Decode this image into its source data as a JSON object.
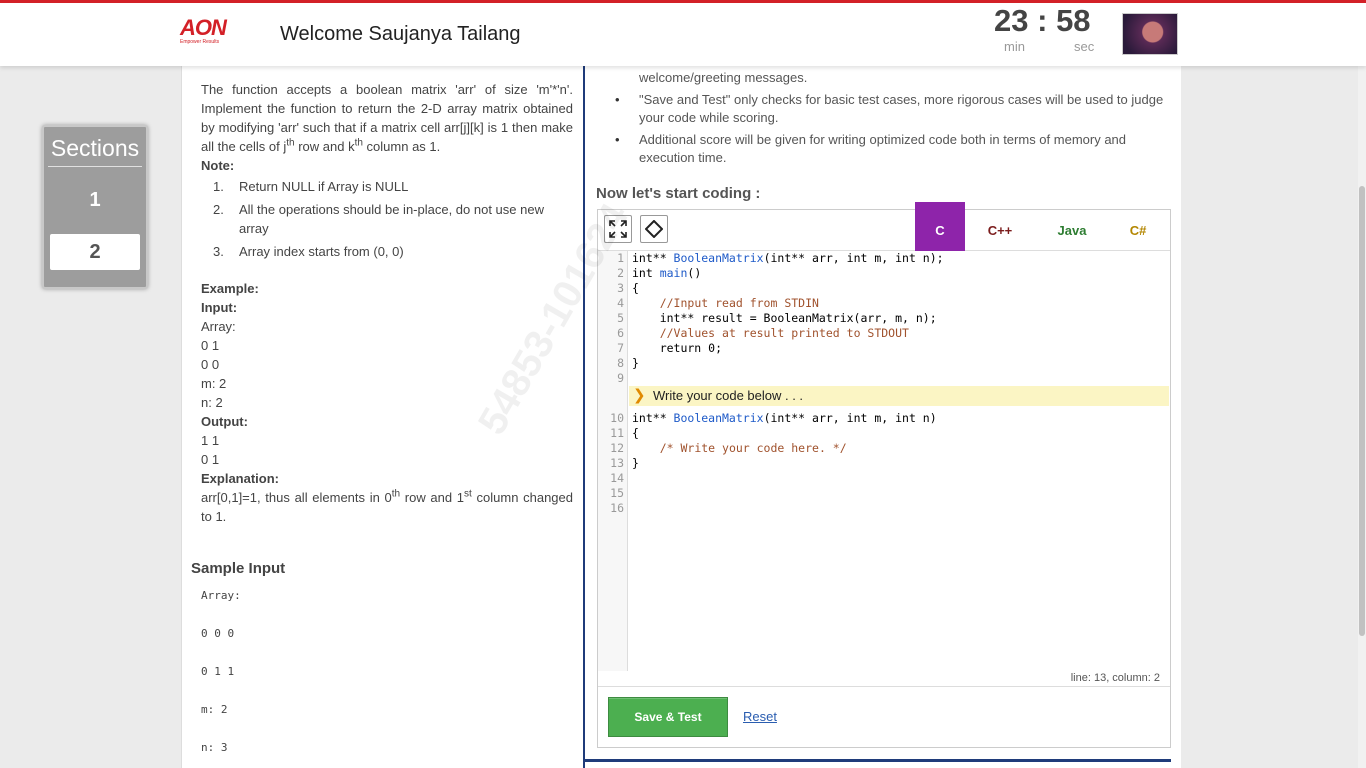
{
  "header": {
    "logo_text": "AON",
    "logo_tagline": "Empower Results",
    "welcome": "Welcome Saujanya Tailang",
    "timer": {
      "minutes": "23",
      "separator": ":",
      "seconds": "58",
      "min_label": "min",
      "sec_label": "sec"
    }
  },
  "sidebar": {
    "title": "Sections",
    "items": [
      {
        "label": "1",
        "active": false
      },
      {
        "label": "2",
        "active": true
      }
    ]
  },
  "question": {
    "para": {
      "t1": "The function accepts a boolean matrix 'arr' of size 'm'*'n'. Implement the function to return the 2-D array matrix obtained by modifying 'arr' such that if a matrix cell arr[j][k] is 1 then make all the cells of j",
      "sup1": "th",
      "t2": " row and k",
      "sup2": "th",
      "t3": " column as 1."
    },
    "note_label": "Note:",
    "notes": [
      {
        "num": "1.",
        "text": "Return NULL if Array is NULL"
      },
      {
        "num": "2.",
        "text": "All the operations should be in-place, do not use new array"
      },
      {
        "num": "3.",
        "text": "Array index starts from (0, 0)"
      }
    ],
    "example_label": "Example:",
    "input_label": "Input:",
    "input_lines": [
      "Array:",
      "0 1",
      "0 0",
      "m: 2",
      "n: 2"
    ],
    "output_label": "Output:",
    "output_lines": [
      "1 1",
      "0 1"
    ],
    "explanation_label": "Explanation:",
    "explanation": {
      "t1": "arr[0,1]=1, thus all elements in 0",
      "sup1": "th",
      "t2": " row and 1",
      "sup2": "st",
      "t3": " column changed to 1."
    },
    "sample_input_title": "Sample Input",
    "sample_input_lines": [
      "Array:",
      "",
      "0 0 0",
      "",
      "0 1 1",
      "",
      "m: 2",
      "",
      "n: 3"
    ]
  },
  "watermark": "54853-101624",
  "instructions": [
    {
      "text": "welcome/greeting messages.",
      "bullet": false
    },
    {
      "text": "\"Save and Test\" only checks for basic test cases, more rigorous cases will be used to judge your code while scoring.",
      "bullet": true
    },
    {
      "text": "Additional score will be given for writing optimized code both in terms of memory and execution time.",
      "bullet": true
    }
  ],
  "start_coding": "Now let's start coding :",
  "editor": {
    "languages": [
      "C",
      "C++",
      "Java",
      "C#"
    ],
    "selected_language": "C",
    "fullscreen_icon": "expand-icon",
    "code_icon": "code-icon",
    "hint": "Write your code below . . .",
    "status": "line: 13, column: 2",
    "locked_lines": [
      {
        "num": "1",
        "parts": [
          [
            "kw",
            "int** "
          ],
          [
            "fn",
            "BooleanMatrix"
          ],
          [
            "kw",
            "(int** arr, int m, int n);"
          ]
        ]
      },
      {
        "num": "2",
        "parts": [
          [
            "kw",
            "int "
          ],
          [
            "fn",
            "main"
          ],
          [
            "kw",
            "()"
          ]
        ]
      },
      {
        "num": "3",
        "parts": [
          [
            "kw",
            "{"
          ]
        ]
      },
      {
        "num": "4",
        "parts": [
          [
            "kw",
            "    "
          ],
          [
            "cm",
            "//Input read from STDIN"
          ]
        ]
      },
      {
        "num": "5",
        "parts": [
          [
            "kw",
            "    int** result = BooleanMatrix(arr, m, n);"
          ]
        ]
      },
      {
        "num": "6",
        "parts": [
          [
            "kw",
            "    "
          ],
          [
            "cm",
            "//Values at result printed to STDOUT"
          ]
        ]
      },
      {
        "num": "7",
        "parts": [
          [
            "kw",
            "    return 0;"
          ]
        ]
      },
      {
        "num": "8",
        "parts": [
          [
            "kw",
            "}"
          ]
        ]
      },
      {
        "num": "9",
        "parts": [
          [
            "kw",
            ""
          ]
        ]
      }
    ],
    "edit_lines": [
      {
        "num": "10",
        "parts": [
          [
            "kw",
            "int** "
          ],
          [
            "fn",
            "BooleanMatrix"
          ],
          [
            "kw",
            "(int** arr, int m, int n)"
          ]
        ]
      },
      {
        "num": "11",
        "parts": [
          [
            "kw",
            "{"
          ]
        ]
      },
      {
        "num": "12",
        "parts": [
          [
            "kw",
            "    "
          ],
          [
            "cm",
            "/* Write your code here. */"
          ]
        ]
      },
      {
        "num": "13",
        "parts": [
          [
            "kw",
            "}"
          ]
        ]
      },
      {
        "num": "14",
        "parts": [
          [
            "kw",
            ""
          ]
        ]
      },
      {
        "num": "15",
        "parts": [
          [
            "kw",
            ""
          ]
        ]
      },
      {
        "num": "16",
        "parts": [
          [
            "kw",
            ""
          ]
        ]
      }
    ],
    "save_label": "Save & Test",
    "reset_label": "Reset"
  }
}
